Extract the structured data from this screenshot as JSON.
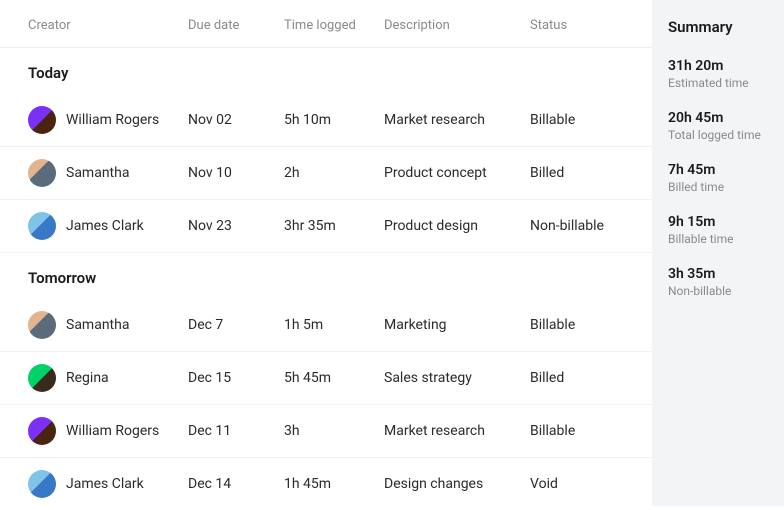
{
  "columns": {
    "creator": "Creator",
    "due": "Due date",
    "time": "Time logged",
    "desc": "Description",
    "status": "Status"
  },
  "groups": [
    {
      "label": "Today",
      "rows": [
        {
          "name": "William Rogers",
          "avatar": "av0",
          "due": "Nov 02",
          "time": "5h 10m",
          "desc": "Market research",
          "status": "Billable"
        },
        {
          "name": "Samantha",
          "avatar": "av1",
          "due": "Nov 10",
          "time": "2h",
          "desc": "Product concept",
          "status": "Billed"
        },
        {
          "name": "James Clark",
          "avatar": "av2",
          "due": "Nov 23",
          "time": "3hr 35m",
          "desc": "Product design",
          "status": "Non-billable"
        }
      ]
    },
    {
      "label": "Tomorrow",
      "rows": [
        {
          "name": "Samantha",
          "avatar": "av1",
          "due": "Dec 7",
          "time": "1h 5m",
          "desc": "Marketing",
          "status": "Billable"
        },
        {
          "name": "Regina",
          "avatar": "av3",
          "due": "Dec 15",
          "time": "5h 45m",
          "desc": "Sales strategy",
          "status": "Billed"
        },
        {
          "name": "William Rogers",
          "avatar": "av0",
          "due": "Dec 11",
          "time": "3h",
          "desc": "Market research",
          "status": "Billable"
        },
        {
          "name": "James Clark",
          "avatar": "av2",
          "due": "Dec 14",
          "time": "1h 45m",
          "desc": "Design changes",
          "status": "Void"
        }
      ]
    }
  ],
  "summary": {
    "title": "Summary",
    "items": [
      {
        "value": "31h 20m",
        "label": "Estimated time"
      },
      {
        "value": "20h 45m",
        "label": "Total logged time"
      },
      {
        "value": "7h 45m",
        "label": "Billed time"
      },
      {
        "value": "9h 15m",
        "label": "Billable time"
      },
      {
        "value": "3h 35m",
        "label": "Non-billable"
      }
    ]
  }
}
